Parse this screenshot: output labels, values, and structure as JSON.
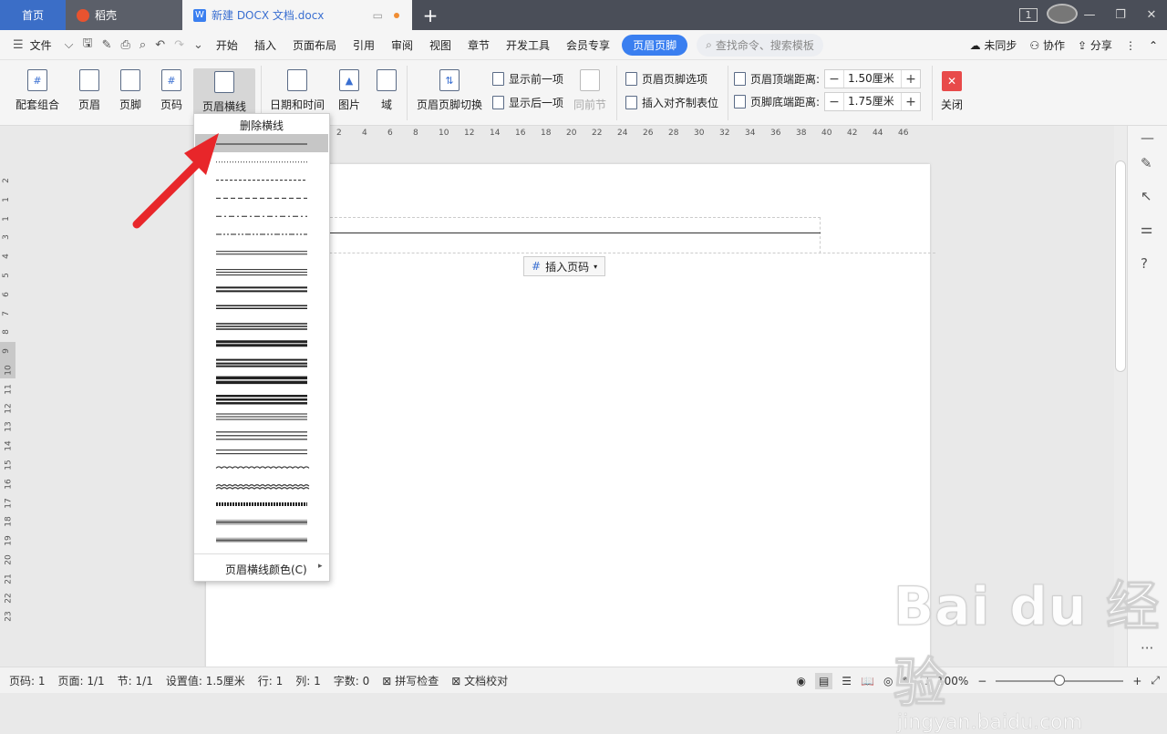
{
  "tabs": {
    "home": "首页",
    "daoke": "稻壳",
    "doc": "新建 DOCX 文档.docx"
  },
  "window": {
    "page_badge": "1"
  },
  "menu": {
    "file": "文件",
    "items": [
      "开始",
      "插入",
      "页面布局",
      "引用",
      "审阅",
      "视图",
      "章节",
      "开发工具",
      "会员专享"
    ],
    "active": "页眉页脚",
    "search_placeholder": "查找命令、搜索模板",
    "sync": "未同步",
    "collab": "协作",
    "share": "分享"
  },
  "ribbon": {
    "combo": "配套组合",
    "header": "页眉",
    "footer": "页脚",
    "page_number": "页码",
    "header_line": "页眉横线",
    "datetime": "日期和时间",
    "picture": "图片",
    "field": "域",
    "switch": "页眉页脚切换",
    "show_prev": "显示前一项",
    "show_next": "显示后一项",
    "same_as_prev": "同前节",
    "options": "页眉页脚选项",
    "insert_tab": "插入对齐制表位",
    "top_dist_label": "页眉顶端距离:",
    "top_dist_value": "1.50厘米",
    "bottom_dist_label": "页脚底端距离:",
    "bottom_dist_value": "1.75厘米",
    "close": "关闭"
  },
  "ruler": {
    "h_ticks": [
      "2",
      "4",
      "6",
      "8",
      "10",
      "12",
      "14",
      "16",
      "18",
      "20",
      "22",
      "24",
      "26",
      "28",
      "30",
      "32",
      "34",
      "36",
      "38",
      "40",
      "42",
      "44",
      "46"
    ],
    "v_ticks": [
      "2",
      "1",
      "1",
      "3",
      "4",
      "5",
      "6",
      "7",
      "8",
      "9",
      "10",
      "11",
      "12",
      "13",
      "14",
      "15",
      "16",
      "17",
      "18",
      "19",
      "20",
      "21",
      "22",
      "23"
    ]
  },
  "document": {
    "insert_page_number": "插入页码"
  },
  "dropdown": {
    "delete": "删除横线",
    "color": "页眉横线颜色(C)"
  },
  "status": {
    "page": "页码: 1",
    "pages": "页面: 1/1",
    "section": "节: 1/1",
    "setting": "设置值: 1.5厘米",
    "row": "行: 1",
    "col": "列: 1",
    "words": "字数: 0",
    "spell": "拼写检查",
    "proof": "文档校对",
    "zoom": "100%",
    "zoom_level": 0.5
  },
  "watermark": {
    "big": "Bai du 经验",
    "small": "jingyan.baidu.com"
  },
  "colors": {
    "accent": "#3a7ff0",
    "arrow": "#e8262a",
    "close": "#e84a4a"
  }
}
